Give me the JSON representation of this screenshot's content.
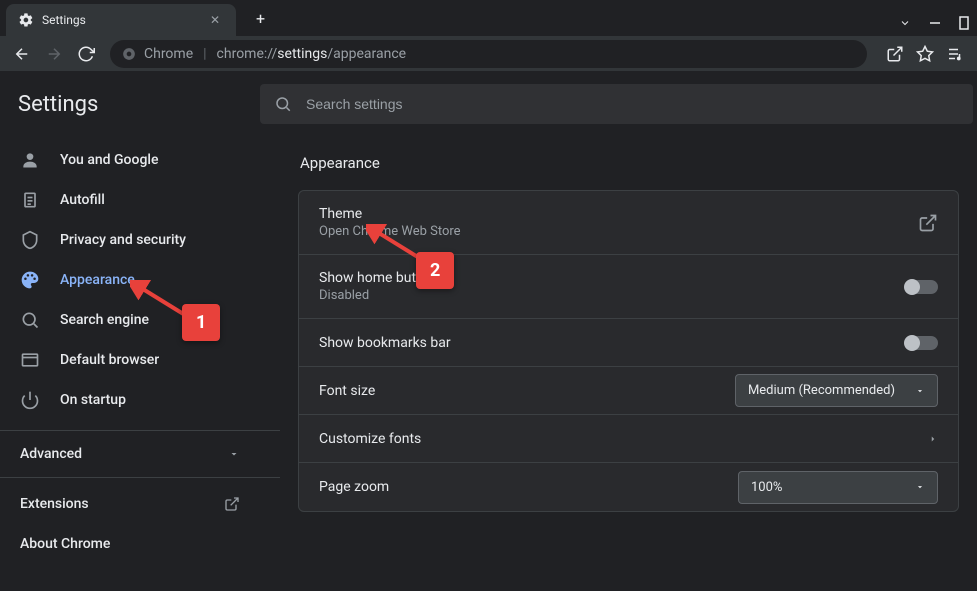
{
  "tab": {
    "title": "Settings"
  },
  "omnibox": {
    "prefix": "Chrome",
    "url_prefix": "chrome://",
    "url_bold": "settings",
    "url_rest": "/appearance"
  },
  "header": {
    "title": "Settings",
    "search_placeholder": "Search settings"
  },
  "sidebar": {
    "items": [
      {
        "label": "You and Google"
      },
      {
        "label": "Autofill"
      },
      {
        "label": "Privacy and security"
      },
      {
        "label": "Appearance"
      },
      {
        "label": "Search engine"
      },
      {
        "label": "Default browser"
      },
      {
        "label": "On startup"
      }
    ],
    "advanced_label": "Advanced",
    "extensions_label": "Extensions",
    "about_label": "About Chrome"
  },
  "main": {
    "section_title": "Appearance",
    "theme": {
      "title": "Theme",
      "sub": "Open Chrome Web Store"
    },
    "home_button": {
      "title": "Show home button",
      "sub": "Disabled"
    },
    "bookmarks": {
      "title": "Show bookmarks bar"
    },
    "font_size": {
      "title": "Font size",
      "value": "Medium (Recommended)"
    },
    "customize_fonts": {
      "title": "Customize fonts"
    },
    "page_zoom": {
      "title": "Page zoom",
      "value": "100%"
    }
  },
  "annotations": {
    "one": "1",
    "two": "2"
  }
}
